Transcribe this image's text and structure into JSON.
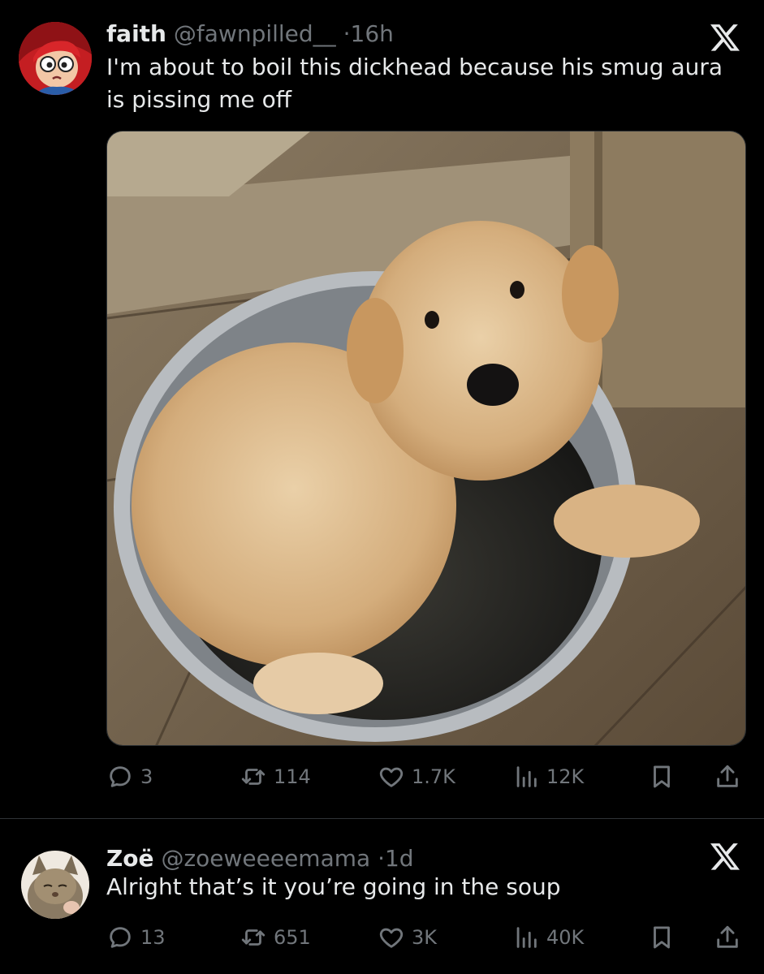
{
  "tweets": [
    {
      "display_name": "faith",
      "handle": "@fawnpilled__",
      "separator": "·",
      "time": "16h",
      "text": "I'm about to boil this dickhead because his smug aura is pissing me off",
      "media_alt": "golden retriever puppy sitting in a metal bowl of water",
      "stats": {
        "replies": "3",
        "reposts": "114",
        "likes": "1.7K",
        "views": "12K"
      }
    },
    {
      "display_name": "Zoë",
      "handle": "@zoeweeeemama",
      "separator": "·",
      "time": "1d",
      "text": "Alright that’s it you’re going in the soup",
      "stats": {
        "replies": "13",
        "reposts": "651",
        "likes": "3K",
        "views": "40K"
      }
    }
  ],
  "icons": {
    "reply": "reply-icon",
    "repost": "repost-icon",
    "like": "heart-icon",
    "views": "views-icon",
    "bookmark": "bookmark-icon",
    "share": "share-icon",
    "brand": "x-logo-icon"
  },
  "colors": {
    "background": "#000000",
    "text": "#e7e9ea",
    "secondary": "#71767b",
    "divider": "#2f3336"
  }
}
